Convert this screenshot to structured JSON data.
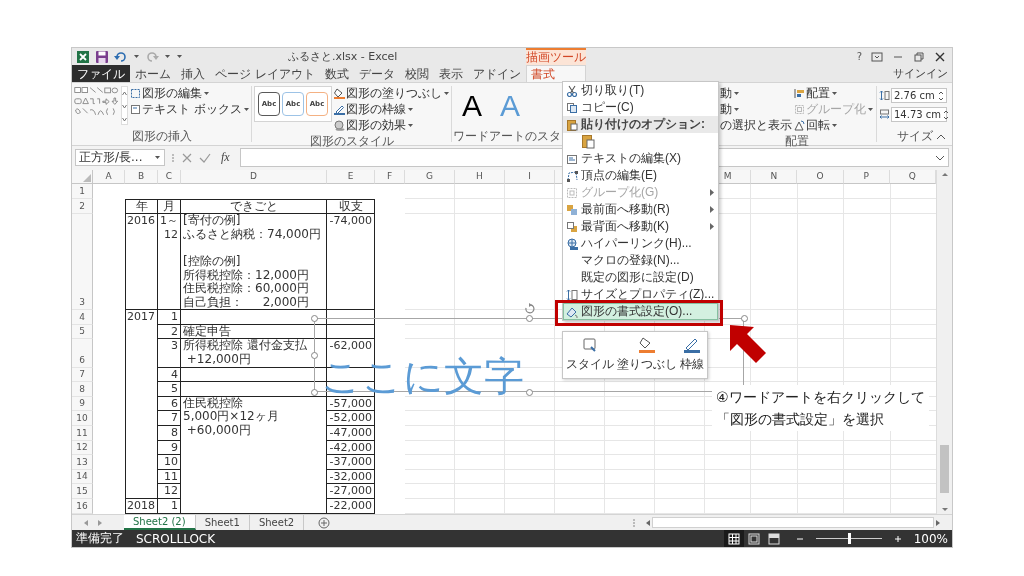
{
  "window": {
    "title": "ふるさと.xlsx - Excel",
    "help": "?",
    "sign_in": "サインイン"
  },
  "tabs": [
    {
      "label": "ファイル",
      "kind": "file",
      "selected": false
    },
    {
      "label": "ホーム",
      "kind": "tab",
      "selected": false
    },
    {
      "label": "挿入",
      "kind": "tab",
      "selected": false
    },
    {
      "label": "ページ レイアウト",
      "kind": "tab",
      "selected": false
    },
    {
      "label": "数式",
      "kind": "tab",
      "selected": false
    },
    {
      "label": "データ",
      "kind": "tab",
      "selected": false
    },
    {
      "label": "校閲",
      "kind": "tab",
      "selected": false
    },
    {
      "label": "表示",
      "kind": "tab",
      "selected": false
    },
    {
      "label": "アドイン",
      "kind": "tab",
      "selected": false
    },
    {
      "label": "書式",
      "kind": "contextual",
      "group": "描画ツール",
      "selected": true
    }
  ],
  "ribbon": {
    "insert_shapes": {
      "label": "図形の挿入",
      "buttons": [
        "図形の編集",
        "テキスト ボックス"
      ]
    },
    "shape_styles": {
      "label": "図形のスタイル",
      "presets": [
        {
          "text": "Abc",
          "color": "#595959"
        },
        {
          "text": "Abc",
          "color": "#9dc3e6"
        },
        {
          "text": "Abc",
          "color": "#f4b183"
        }
      ],
      "buttons": [
        "図形の塗りつぶし",
        "図形の枠線",
        "図形の効果"
      ]
    },
    "wordart_styles": {
      "label": "ワードアートのスタ",
      "presets": [
        {
          "text": "A",
          "color": "#000000"
        },
        {
          "text": "A",
          "color": "#5b9bd5"
        }
      ]
    },
    "arrange": {
      "label": "配置",
      "covered_items": [
        {
          "text": "動",
          "dropdown": true
        },
        {
          "text": "動",
          "dropdown": true
        },
        {
          "text": "の選択と表示",
          "dropdown": false
        }
      ],
      "buttons": [
        {
          "label": "配置",
          "disabled": false
        },
        {
          "label": "グループ化",
          "disabled": true
        },
        {
          "label": "回転",
          "disabled": false
        }
      ]
    },
    "size": {
      "label": "サイズ",
      "height": "2.76 cm",
      "width": "14.73 cm"
    }
  },
  "formula_bar": {
    "name_box": "正方形/長...",
    "function_button": "fx"
  },
  "sheet": {
    "columns_left": [
      "A",
      "B",
      "C",
      "D",
      "E",
      "F",
      "G",
      "H",
      "I"
    ],
    "columns_right": [
      "M",
      "N",
      "O",
      "P",
      "Q"
    ],
    "rows": [
      {
        "label": "1"
      },
      {
        "label": "2",
        "kind": "header",
        "year": "年",
        "month": "月",
        "event": "できごと",
        "balance": "収支"
      },
      {
        "label": "3",
        "kind": "data",
        "year": "2016",
        "month": [
          "1～",
          "12"
        ],
        "event": [
          [
            "[寄付の例]",
            "ふるさと納税：74,000円"
          ],
          [
            "[控除の例]",
            "所得税控除：12,000円",
            "住民税控除：60,000円",
            "自己負担：　  2,000円"
          ]
        ],
        "balance": "-74,000"
      },
      {
        "label": "4",
        "kind": "data",
        "year": "2017",
        "month": "1"
      },
      {
        "label": "5",
        "kind": "data",
        "year_merged": true,
        "month": "2",
        "event": "確定申告"
      },
      {
        "label": "6",
        "kind": "data",
        "year_merged": true,
        "month": "3",
        "event": [
          "所得税控除 還付金支払",
          " +12,000円"
        ],
        "balance": "-62,000"
      },
      {
        "label": "7",
        "kind": "data",
        "year_merged": true,
        "month": "4"
      },
      {
        "label": "8",
        "kind": "data",
        "year_merged": true,
        "month": "5"
      },
      {
        "label": "9",
        "kind": "data",
        "year_merged": true,
        "month": "6",
        "event": [
          "住民税控除",
          "5,000円×12ヶ月",
          " +60,000円"
        ],
        "balance": "-57,000"
      },
      {
        "label": "10",
        "kind": "data",
        "year_merged": true,
        "month": "7",
        "event_merged": true,
        "balance": "-52,000"
      },
      {
        "label": "11",
        "kind": "data",
        "year_merged": true,
        "month": "8",
        "event_merged": true,
        "balance": "-47,000"
      },
      {
        "label": "12",
        "kind": "data",
        "year_merged": true,
        "month": "9",
        "event_merged": true,
        "balance": "-42,000"
      },
      {
        "label": "13",
        "kind": "data",
        "year_merged": true,
        "month": "10",
        "event_merged": true,
        "balance": "-37,000"
      },
      {
        "label": "14",
        "kind": "data",
        "year_merged": true,
        "month": "11",
        "event_merged": true,
        "balance": "-32,000"
      },
      {
        "label": "15",
        "kind": "data",
        "year_merged": true,
        "month": "12",
        "event_merged": true,
        "balance": "-27,000"
      },
      {
        "label": "16",
        "kind": "data",
        "year": "2018",
        "month": "1",
        "event_merged": true,
        "balance": "-22,000"
      }
    ]
  },
  "wordart": {
    "text": "ここに文字"
  },
  "context_menu": {
    "items": [
      {
        "kind": "item",
        "label": "切り取り(T)",
        "disabled": false,
        "submenu": false,
        "selected": false
      },
      {
        "kind": "item",
        "label": "コピー(C)",
        "disabled": false,
        "submenu": false,
        "selected": false
      },
      {
        "kind": "header",
        "label": "貼り付けのオプション:"
      },
      {
        "kind": "paste-option"
      },
      {
        "kind": "item",
        "label": "テキストの編集(X)",
        "disabled": false,
        "submenu": false,
        "selected": false
      },
      {
        "kind": "item",
        "label": "頂点の編集(E)",
        "disabled": false,
        "submenu": false,
        "selected": false
      },
      {
        "kind": "item",
        "label": "グループ化(G)",
        "disabled": true,
        "submenu": true,
        "selected": false
      },
      {
        "kind": "item",
        "label": "最前面へ移動(R)",
        "disabled": false,
        "submenu": true,
        "selected": false
      },
      {
        "kind": "item",
        "label": "最背面へ移動(K)",
        "disabled": false,
        "submenu": true,
        "selected": false
      },
      {
        "kind": "item",
        "label": "ハイパーリンク(H)...",
        "disabled": false,
        "submenu": false,
        "selected": false
      },
      {
        "kind": "item",
        "label": "マクロの登録(N)...",
        "disabled": false,
        "submenu": false,
        "selected": false
      },
      {
        "kind": "item",
        "label": "既定の図形に設定(D)",
        "disabled": false,
        "submenu": false,
        "selected": false
      },
      {
        "kind": "item",
        "label": "サイズとプロパティ(Z)...",
        "disabled": false,
        "submenu": false,
        "selected": false
      },
      {
        "kind": "item",
        "label": "図形の書式設定(O)...",
        "disabled": false,
        "submenu": false,
        "selected": true
      }
    ]
  },
  "mini_toolbar": {
    "buttons": [
      "スタイル",
      "塗りつぶし",
      "枠線"
    ]
  },
  "callout": {
    "lines": [
      "④ワードアートを右クリックして",
      "「図形の書式設定」を選択"
    ]
  },
  "sheet_tabs": [
    {
      "label": "Sheet2 (2)",
      "selected": true
    },
    {
      "label": "Sheet1",
      "selected": false
    },
    {
      "label": "Sheet2",
      "selected": false
    }
  ],
  "status_bar": {
    "ready": "準備完了",
    "scroll_lock": "SCROLLLOCK",
    "views": [
      {
        "kind": "normal",
        "selected": true
      },
      {
        "kind": "page-layout",
        "selected": false
      },
      {
        "kind": "page-break",
        "selected": false
      }
    ],
    "zoom": {
      "level": 0.5,
      "label": "100%"
    }
  }
}
